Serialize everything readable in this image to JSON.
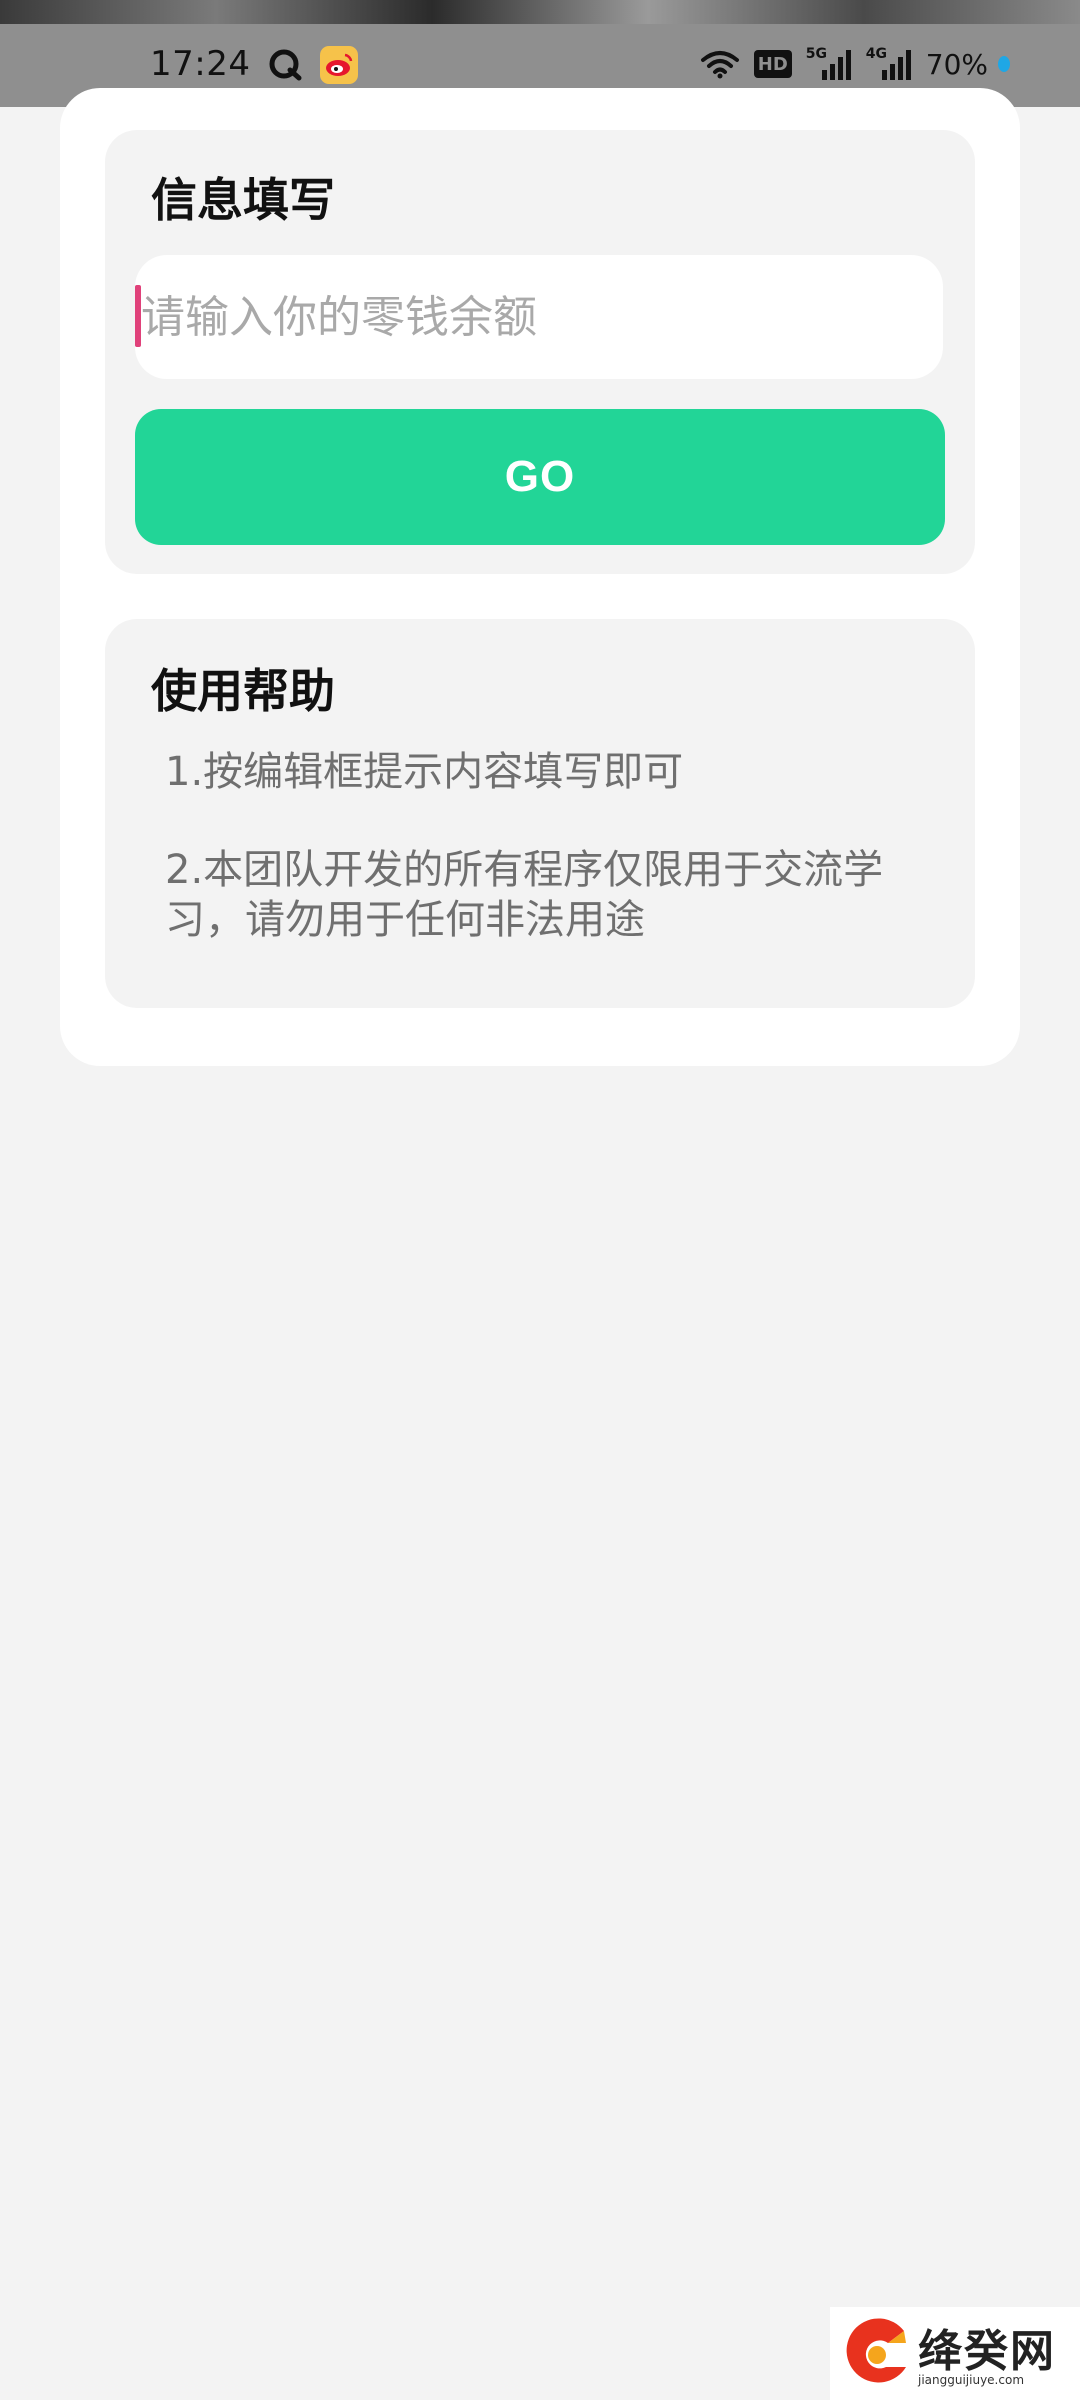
{
  "status_bar": {
    "time": "17:24",
    "hd": "HD",
    "net_5g": "5G",
    "net_4g": "4G",
    "battery": "70%",
    "icons": [
      "q-app-icon",
      "weibo-icon",
      "wifi-icon",
      "hd-icon",
      "signal-5g-icon",
      "signal-4g-icon",
      "battery-dot-icon"
    ]
  },
  "info_section": {
    "title": "信息填写",
    "input_placeholder": "请输入你的零钱余额",
    "input_value": "",
    "go_label": "GO"
  },
  "help_section": {
    "title": "使用帮助",
    "items": [
      "1.按编辑框提示内容填写即可",
      "2.本团队开发的所有程序仅限用于交流学习，请勿用于任何非法用途"
    ]
  },
  "watermark": {
    "name": "绛癸网",
    "url": "jiangguijiuye.com"
  },
  "colors": {
    "accent": "#22d597",
    "cursor": "#e0417a",
    "panel_bg": "#f3f3f3",
    "page_bg": "#f3f3f3",
    "card_bg": "#ffffff"
  }
}
